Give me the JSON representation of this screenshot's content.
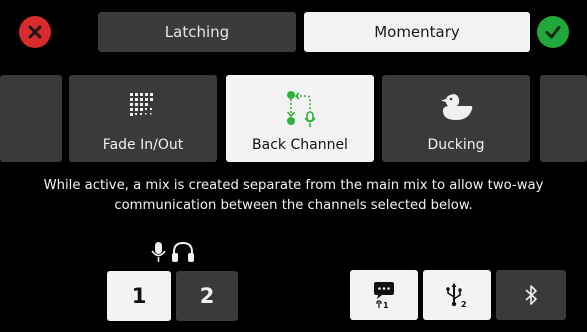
{
  "top_bar": {
    "modes": [
      {
        "label": "Latching",
        "selected": false
      },
      {
        "label": "Momentary",
        "selected": true
      }
    ],
    "cancel_icon": "close-icon",
    "confirm_icon": "checkmark-icon"
  },
  "effects": [
    {
      "label": "Fade In/Out",
      "icon": "grid-dots-icon",
      "selected": false
    },
    {
      "label": "Back Channel",
      "icon": "back-channel-icon",
      "selected": true
    },
    {
      "label": "Ducking",
      "icon": "duck-icon",
      "selected": false
    }
  ],
  "description": "While active, a mix is created separate from the main mix to allow two-way communication between the channels selected below.",
  "channels": {
    "indicator_icons": [
      "microphone-icon",
      "headphones-icon"
    ],
    "buttons": [
      {
        "label": "1",
        "selected": true
      },
      {
        "label": "2",
        "selected": false
      }
    ]
  },
  "sources": [
    {
      "icon": "talkback-chat-icon",
      "subscript": "1",
      "selected": true
    },
    {
      "icon": "usb-icon",
      "subscript": "2",
      "selected": true
    },
    {
      "icon": "bluetooth-icon",
      "selected": false
    }
  ],
  "colors": {
    "cancel": "#d92b2b",
    "confirm": "#22a83a",
    "selected_bg": "#f3f3f3",
    "unselected_bg": "#3a3a3a",
    "accent_green": "#2fb33a"
  }
}
